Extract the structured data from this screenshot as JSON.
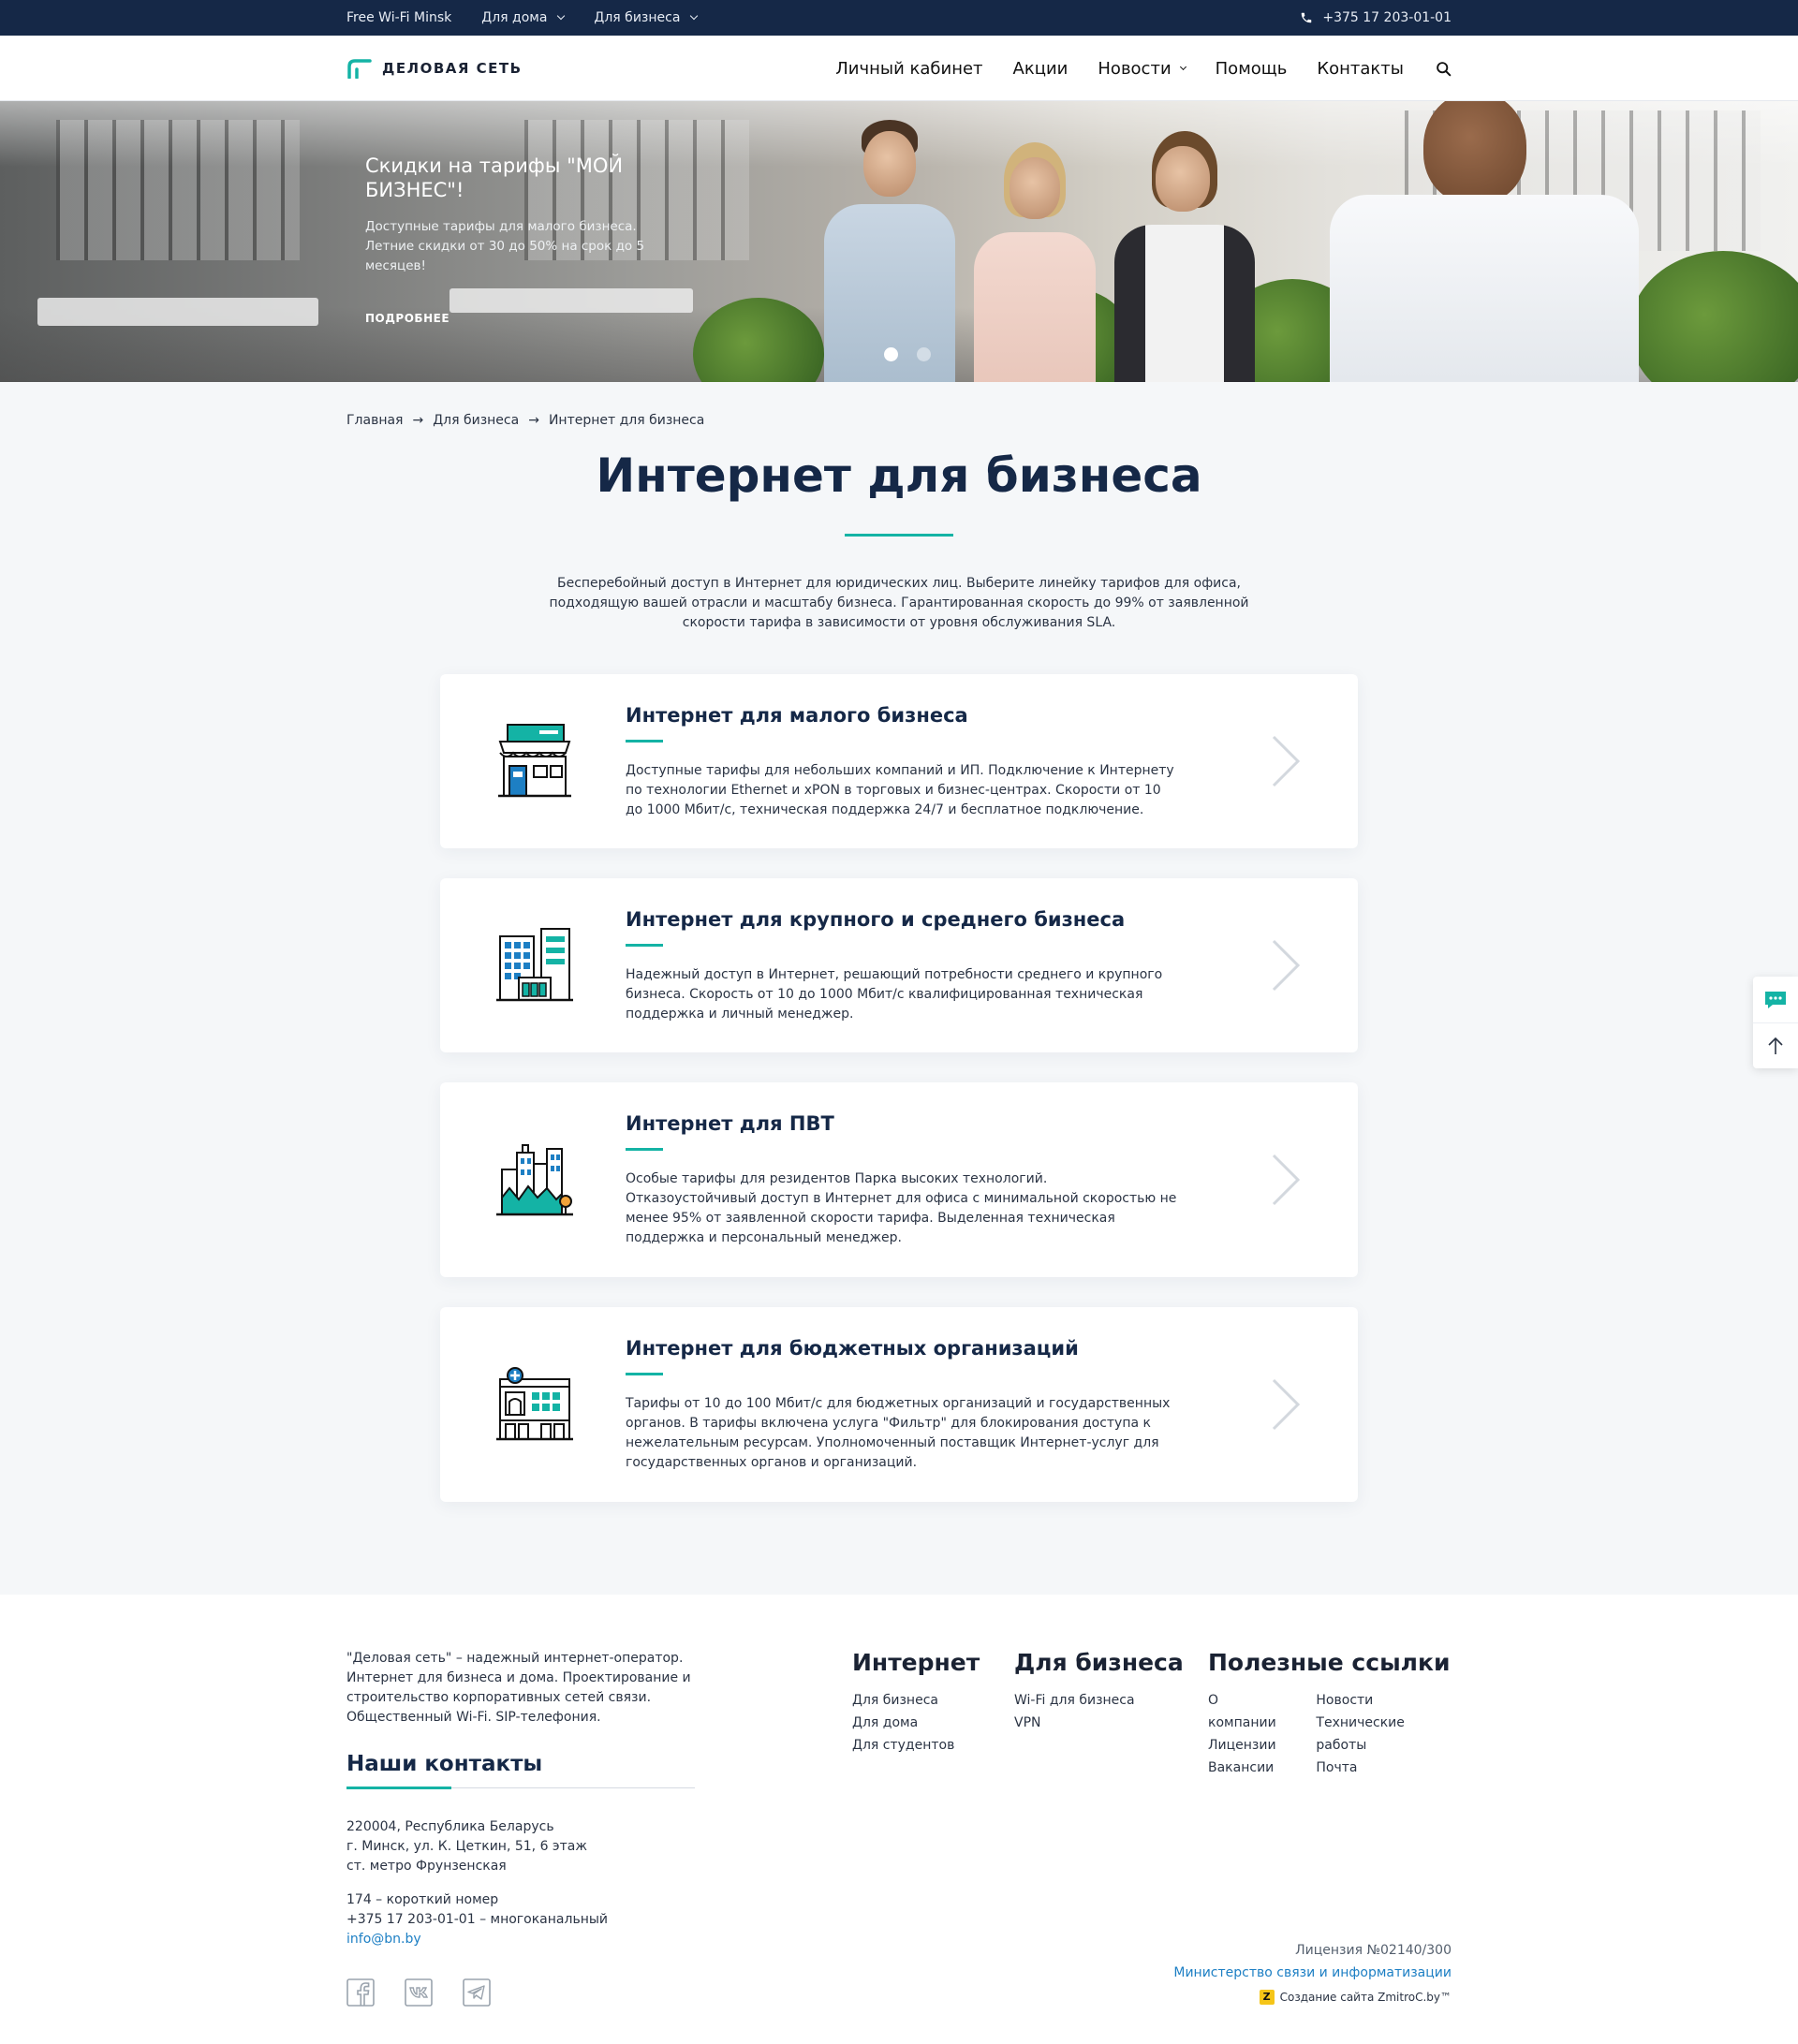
{
  "topbar": {
    "links": [
      {
        "label": "Free Wi-Fi Minsk",
        "dropdown": false
      },
      {
        "label": "Для дома",
        "dropdown": true
      },
      {
        "label": "Для бизнеса",
        "dropdown": true
      }
    ],
    "phone": "+375 17 203-01-01",
    "phone_icon": "phone-icon"
  },
  "header": {
    "logo_text": "ДЕЛОВАЯ СЕТЬ",
    "nav": [
      {
        "label": "Личный кабинет",
        "dropdown": false
      },
      {
        "label": "Акции",
        "dropdown": false
      },
      {
        "label": "Новости",
        "dropdown": true
      },
      {
        "label": "Помощь",
        "dropdown": false
      },
      {
        "label": "Контакты",
        "dropdown": false
      }
    ],
    "search_icon": "search-icon"
  },
  "hero": {
    "title": "Скидки на тарифы \"МОЙ БИЗНЕС\"!",
    "description": "Доступные тарифы для малого бизнеса. Летние скидки от 30 до 50% на срок до 5 месяцев!",
    "more_label": "ПОДРОБНЕЕ",
    "slides_count": 2,
    "active_slide": 1
  },
  "breadcrumb": [
    "Главная",
    "Для бизнеса",
    "Интернет для бизнеса"
  ],
  "page": {
    "title": "Интернет для бизнеса",
    "intro": "Бесперебойный доступ в Интернет для юридических лиц. Выберите линейку тарифов для офиса, подходящую вашей отрасли и масштабу бизнеса. Гарантированная скорость до 99% от заявленной скорости тарифа в зависимости от уровня обслуживания SLA."
  },
  "cards": [
    {
      "icon": "shop-icon",
      "title": "Интернет для малого бизнеса",
      "description": "Доступные тарифы для небольших компаний и ИП. Подключение к Интернету по технологии Ethernet и xPON в торговых и бизнес-центрах. Скорости от 10 до 1000 Мбит/с, техническая поддержка 24/7 и бесплатное подключение."
    },
    {
      "icon": "office-buildings-icon",
      "title": "Интернет для крупного и среднего бизнеса",
      "description": "Надежный доступ в Интернет, решающий потребности среднего и крупного бизнеса. Скорость от 10 до 1000 Мбит/с квалифицированная техническая поддержка и личный менеджер."
    },
    {
      "icon": "city-park-icon",
      "title": "Интернет для ПВТ",
      "description": "Особые тарифы для резидентов Парка высоких технологий. Отказоустойчивый доступ в Интернет для офиса с минимальной скоростью не менее 95% от заявленной скорости тарифа. Выделенная техническая поддержка и персональный менеджер."
    },
    {
      "icon": "hospital-icon",
      "title": "Интернет для бюджетных организаций",
      "description": "Тарифы от 10 до 100 Мбит/с для бюджетных организаций и государственных органов. В тарифы включена услуга \"Фильтр\" для блокирования доступа к нежелательным ресурсам. Уполномоченный поставщик Интернет-услуг для государственных органов и организаций."
    }
  ],
  "footer": {
    "about": "\"Деловая сеть\" – надежный интернет-оператор. Интернет для бизнеса и дома. Проектирование и строительство корпоративных сетей связи. Общественный Wi-Fi. SIP-телефония.",
    "contacts_title": "Наши контакты",
    "address": [
      "220004, Республика Беларусь",
      "г. Минск, ул. К. Цеткин, 51, 6 этаж",
      "ст. метро Фрунзенская"
    ],
    "phones": [
      "174 – короткий номер",
      "+375 17 203-01-01 – многоканальный"
    ],
    "email": "info@bn.by",
    "social": [
      "facebook-icon",
      "vk-icon",
      "telegram-icon"
    ],
    "col_internet": {
      "title": "Интернет",
      "links": [
        "Для бизнеса",
        "Для дома",
        "Для студентов"
      ]
    },
    "col_business": {
      "title": "Для бизнеса",
      "links": [
        "Wi-Fi для бизнеса",
        "VPN"
      ]
    },
    "col_useful": {
      "title": "Полезные ссылки",
      "links_left": [
        "О компании",
        "Лицензии",
        "Вакансии"
      ],
      "links_right": [
        "Новости",
        "Технические работы",
        "Почта"
      ]
    },
    "license": "Лицензия №02140/300",
    "ministry": "Министерство связи и информатизации",
    "developer": "Создание сайта ZmitroC.by™",
    "developer_icon_letter": "Z"
  },
  "side_widget": {
    "chat_icon": "chat-icon",
    "up_icon": "arrow-up-icon"
  },
  "colors": {
    "dark_navy": "#152847",
    "accent_teal": "#14b3a5",
    "link_blue": "#1d7fc4"
  }
}
